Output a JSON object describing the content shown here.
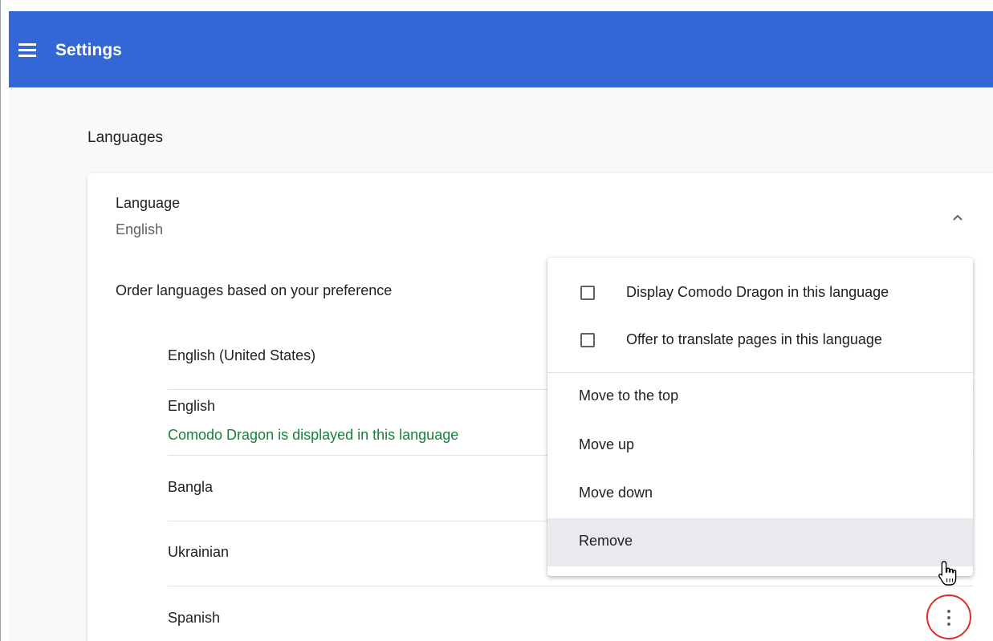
{
  "header": {
    "title": "Settings",
    "menu_icon": "hamburger-menu-icon",
    "color": "#3367d6"
  },
  "section": {
    "title": "Languages"
  },
  "language_card": {
    "heading": "Language",
    "current": "English",
    "collapse_icon": "chevron-up-icon",
    "order_label": "Order languages based on your preference",
    "languages": [
      {
        "name": "English (United States)"
      },
      {
        "name": "English",
        "note": "Comodo Dragon is displayed in this language"
      },
      {
        "name": "Bangla"
      },
      {
        "name": "Ukrainian"
      },
      {
        "name": "Spanish"
      }
    ],
    "more_actions_icon": "more-vert-icon",
    "note_color": "#188038"
  },
  "context_menu": {
    "checkboxes": [
      {
        "label": "Display Comodo Dragon in this language",
        "checked": false
      },
      {
        "label": "Offer to translate pages in this language",
        "checked": false
      }
    ],
    "items": [
      {
        "label": "Move to the top"
      },
      {
        "label": "Move up"
      },
      {
        "label": "Move down"
      },
      {
        "label": "Remove",
        "hovered": true
      }
    ]
  },
  "annotation": {
    "highlight_color": "#e32a2a"
  },
  "cursor": "hand-pointer-icon"
}
